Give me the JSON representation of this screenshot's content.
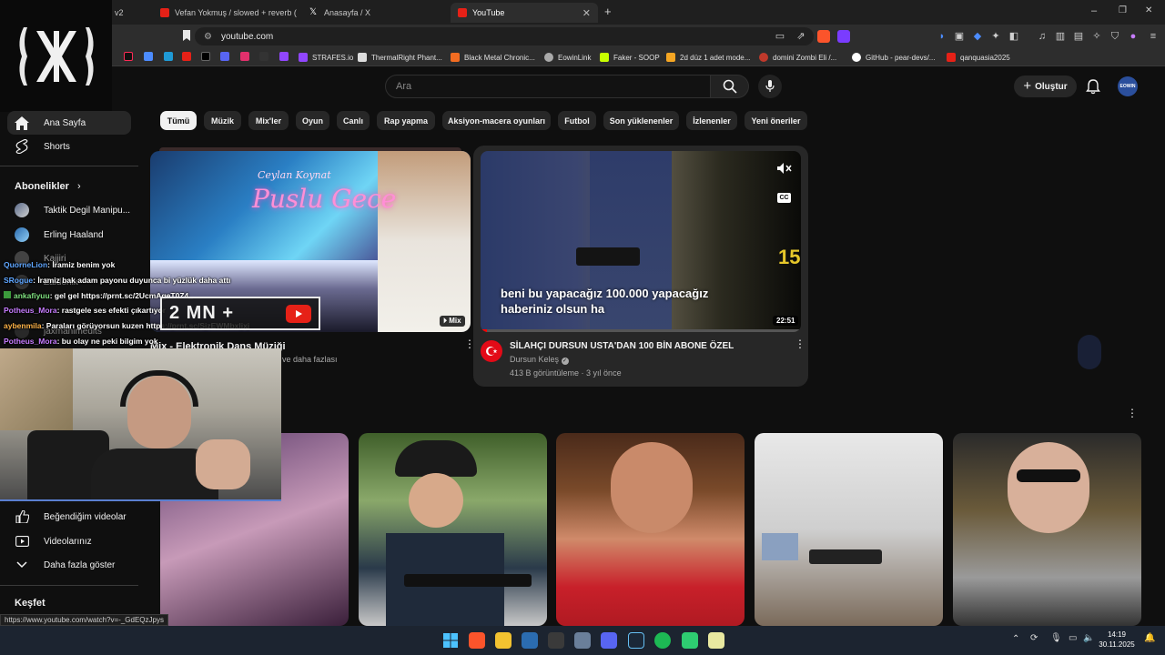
{
  "browser": {
    "tabs": [
      {
        "label": "v2",
        "active": false
      },
      {
        "label": "Vefan Yokmuş / slowed + reverb (Me",
        "active": false
      },
      {
        "label": "Anasayfa / X",
        "active": false
      },
      {
        "label": "YouTube",
        "active": true
      }
    ],
    "new_tab": "+",
    "url": "youtube.com",
    "bookmarks": [
      "STRAFES.io",
      "ThermalRight Phant...",
      "Black Metal Chronic...",
      "EowinLink",
      "Faker - SOOP",
      "2d düz 1 adet mode...",
      "domini Zombi Eli /...",
      "GitHub - pear-devs/...",
      "qanquasia2025"
    ],
    "window_controls": {
      "minimize": "–",
      "restore": "❐",
      "close": "✕"
    }
  },
  "youtube": {
    "search_placeholder": "Ara",
    "create_label": "Oluştur",
    "avatar_text": "EOWIN",
    "chips": [
      "Tümü",
      "Müzik",
      "Mix'ler",
      "Oyun",
      "Canlı",
      "Rap yapma",
      "Aksiyon-macera oyunları",
      "Futbol",
      "Son yüklenenler",
      "İzlenenler",
      "Yeni öneriler"
    ],
    "sidebar": {
      "home": "Ana Sayfa",
      "shorts": "Shorts",
      "subscriptions": "Abonelikler",
      "subs": [
        "Taktik Degil Manipu...",
        "Erling Haaland",
        "Kajjiri",
        "Zaldonik",
        "jaxmanimedits"
      ],
      "liked": "Beğendiğim videolar",
      "your_videos": "Videolarınız",
      "show_more": "Daha fazla göster",
      "explore": "Keşfet"
    },
    "video1": {
      "title": "Mix - Elektronik Dans Müziği",
      "meta": "ve daha fazlası",
      "badge": "Mix",
      "thumb_text": "Puslu Gece",
      "thumb_artist": "Ceylan Koynat"
    },
    "video2": {
      "title": "SİLAHÇI DURSUN USTA'DAN 100 BİN ABONE ÖZEL",
      "channel": "Dursun Keleş",
      "meta": "413 B görüntüleme · 3 yıl önce",
      "duration": "22:51",
      "caption_line1": "beni bu yapacağız 100.000 yapacağız",
      "caption_line2": "haberiniz olsun ha",
      "cc": "CC"
    }
  },
  "stream_overlay": {
    "chat": [
      {
        "user": "QuorneLion",
        "color": "#5fa6ff",
        "msg": ": İramiz benim yok"
      },
      {
        "user": "SRogue",
        "color": "#5fa6ff",
        "msg": ": İramiz bak adam payonu duyunca bi yüzlük daha attı"
      },
      {
        "user": "ankafiyuu",
        "color": "#7fe07f",
        "msg": ": gel gel https://prnt.sc/2UcmAgeT0Z4_"
      },
      {
        "user": "Potheus_Mora",
        "color": "#c77dff",
        "msg": ": rastgele ses efekti çıkartıyor"
      },
      {
        "user": "aybenmila",
        "color": "#ffb347",
        "msg": ": Paraları görüyorsun kuzen https://prnt.sc/SjzEWMbxljxj"
      },
      {
        "user": "Potheus_Mora",
        "color": "#c77dff",
        "msg": ": bu olay ne peki bilgim yok"
      }
    ],
    "donation": "2 MN +"
  },
  "status_url": "https://www.youtube.com/watch?v=-_GdEQzJpys",
  "clock": {
    "time": "14:19",
    "date": "30.11.2025"
  }
}
